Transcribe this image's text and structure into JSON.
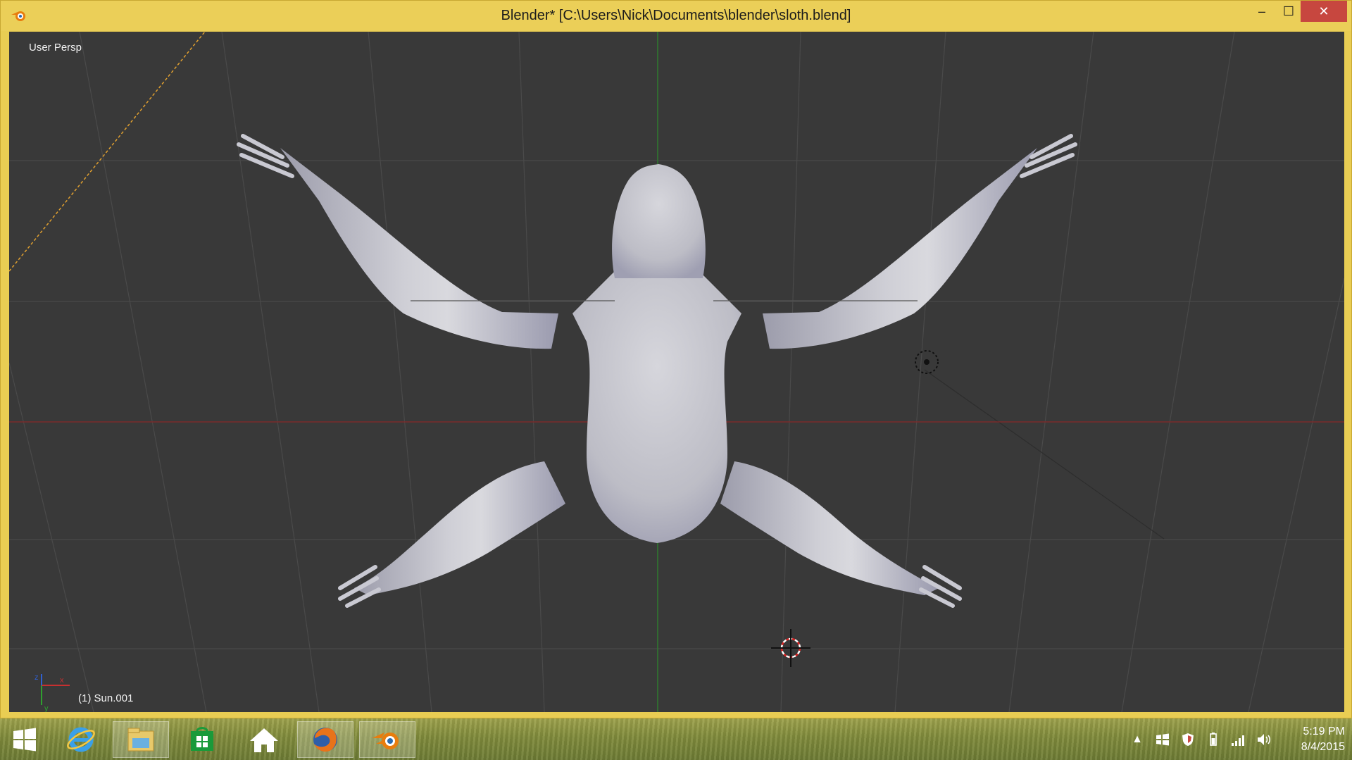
{
  "window": {
    "title": "Blender* [C:\\Users\\Nick\\Documents\\blender\\sloth.blend]",
    "minimize_label": "–",
    "maximize_label": "☐",
    "close_label": "✕"
  },
  "viewport": {
    "view_label": "User Persp",
    "object_label": "(1) Sun.001",
    "axis_labels": {
      "x": "x",
      "y": "y",
      "z": "z"
    }
  },
  "taskbar": {
    "items": [
      {
        "name": "start-button",
        "icon": "windows-logo-icon"
      },
      {
        "name": "internet-explorer",
        "icon": "internet-explorer-icon"
      },
      {
        "name": "file-explorer",
        "icon": "folder-icon"
      },
      {
        "name": "windows-store",
        "icon": "store-icon"
      },
      {
        "name": "home",
        "icon": "home-icon"
      },
      {
        "name": "firefox",
        "icon": "firefox-icon"
      },
      {
        "name": "blender",
        "icon": "blender-icon",
        "active": true
      }
    ],
    "clock": {
      "time": "5:19 PM",
      "date": "8/4/2015"
    }
  },
  "colors": {
    "title_bar": "#ebcf58",
    "viewport_bg": "#393939",
    "close_button": "#c7473f",
    "x_axis": "#b83030",
    "y_axis": "#2f9a2f",
    "mesh": "#c7c7cf"
  }
}
